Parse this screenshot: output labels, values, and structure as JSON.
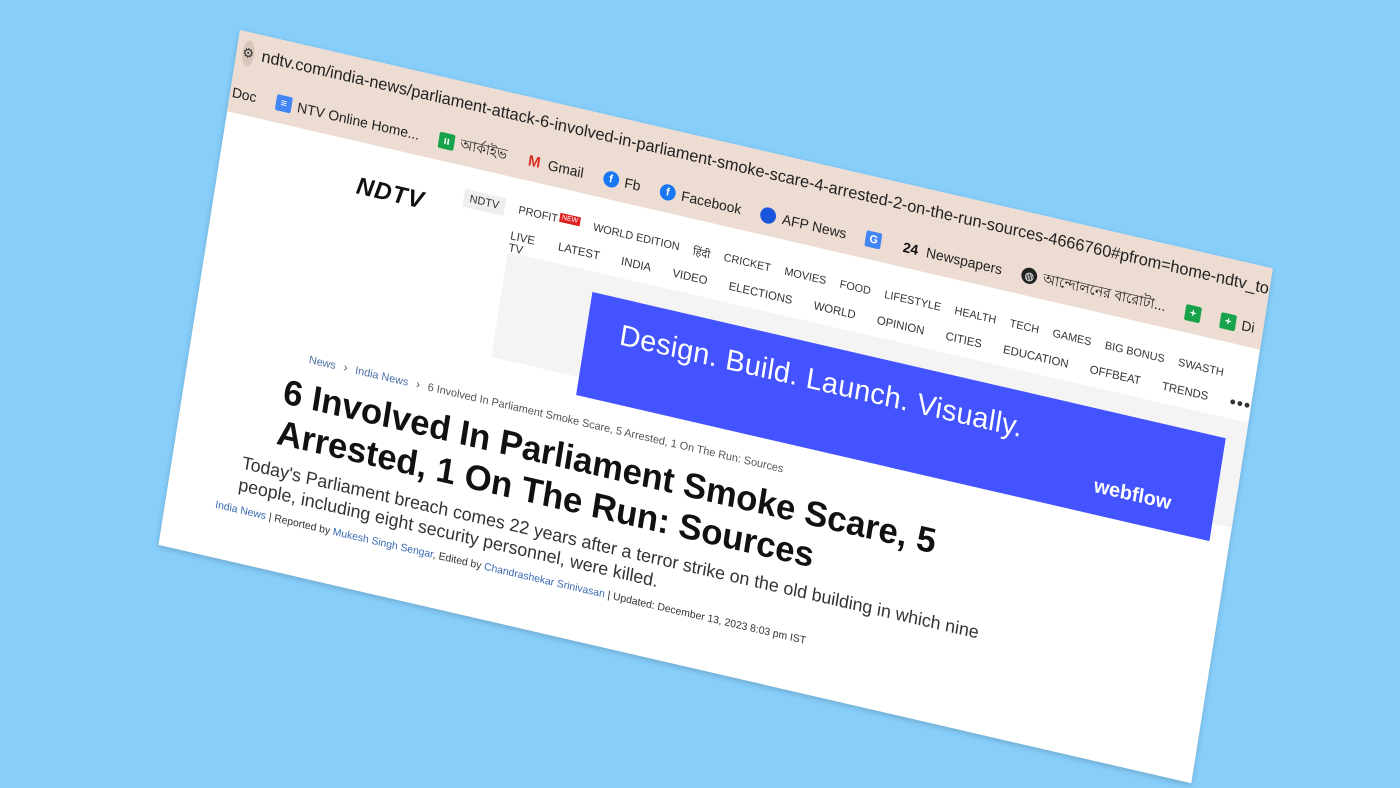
{
  "browser": {
    "url": "ndtv.com/india-news/parliament-attack-6-involved-in-parliament-smoke-scare-4-arrested-2-on-the-run-sources-4666760#pfrom=home-ndtv_topscroll",
    "bookmarks": [
      {
        "label": "Doc",
        "icon": "doc-icon"
      },
      {
        "label": "NTV Online Home...",
        "icon": "doc-icon"
      },
      {
        "label": "আর্কাইভ",
        "icon": "archive-icon"
      },
      {
        "label": "Gmail",
        "icon": "gmail-icon"
      },
      {
        "label": "Fb",
        "icon": "facebook-icon"
      },
      {
        "label": "Facebook",
        "icon": "facebook-icon"
      },
      {
        "label": "AFP News",
        "icon": "afp-icon"
      },
      {
        "label": "",
        "icon": "translate-icon"
      },
      {
        "label": "Newspapers",
        "icon": "24-icon"
      },
      {
        "label": "আন্দোলনের বারোটা...",
        "icon": "globe-icon"
      },
      {
        "label": "",
        "icon": "plus-icon"
      },
      {
        "label": "Di",
        "icon": "plus-icon"
      }
    ]
  },
  "header": {
    "logo": "NDTV",
    "nav_top": [
      "NDTV",
      "PROFIT",
      "WORLD EDITION",
      "हिंदी",
      "CRICKET",
      "MOVIES",
      "FOOD",
      "LIFESTYLE",
      "HEALTH",
      "TECH",
      "GAMES",
      "BIG BONUS",
      "SWASTH"
    ],
    "new_badge": "NEW",
    "nav_bottom": [
      "LIVE TV",
      "LATEST",
      "INDIA",
      "VIDEO",
      "ELECTIONS",
      "WORLD",
      "OPINION",
      "CITIES",
      "EDUCATION",
      "OFFBEAT",
      "TRENDS"
    ],
    "more": "•••"
  },
  "ad": {
    "headline": "Design. Build. Launch. Visually.",
    "brand": "webflow"
  },
  "article": {
    "breadcrumb": [
      "News",
      "India News",
      "6 Involved In Parliament Smoke Scare, 5 Arrested, 1 On The Run: Sources"
    ],
    "title": "6 Involved In Parliament Smoke Scare, 5 Arrested, 1 On The Run: Sources",
    "summary": "Today's Parliament breach comes 22 years after a terror strike on the old building in which nine people, including eight security personnel, were killed.",
    "byline": {
      "section": "India News",
      "reported_prefix": "Reported by",
      "reporter": "Mukesh Singh Sengar",
      "edited_prefix": ", Edited by",
      "editor": "Chandrashekar Srinivasan",
      "updated": "Updated: December 13, 2023 8:03 pm IST"
    }
  }
}
